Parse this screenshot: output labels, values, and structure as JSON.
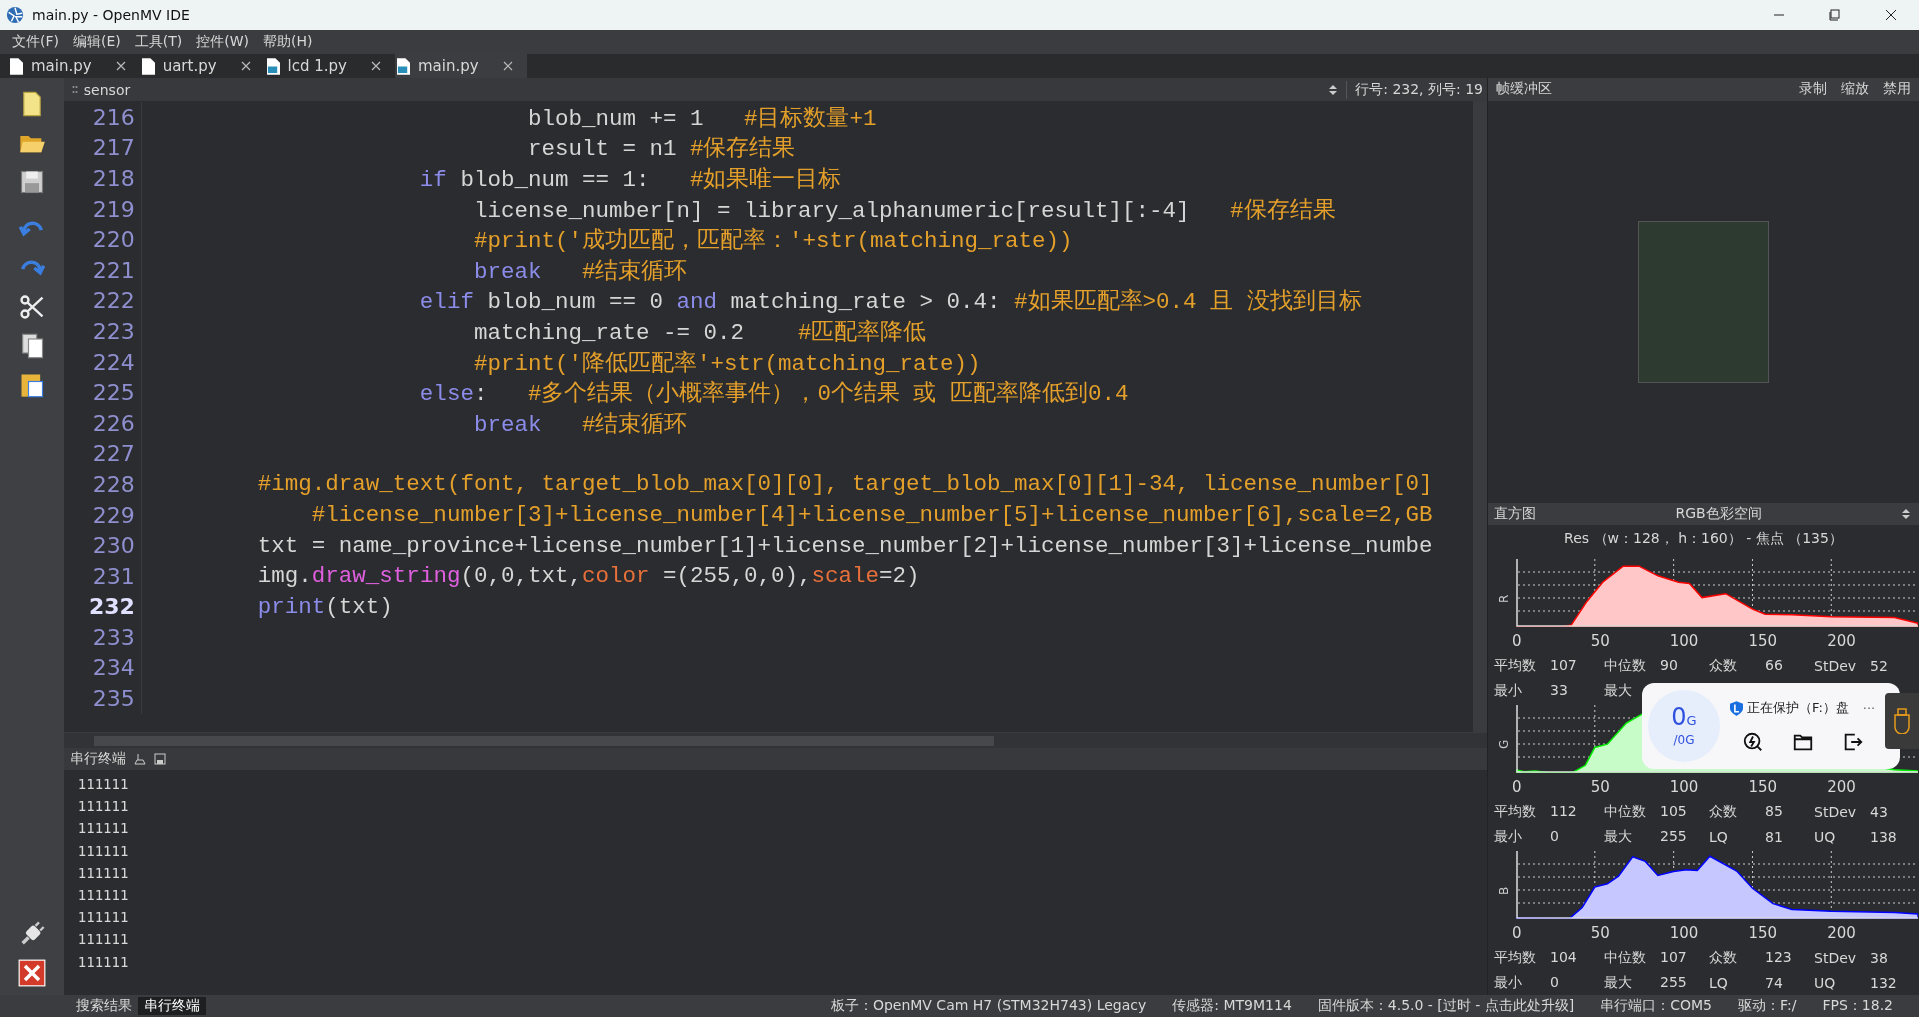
{
  "window": {
    "title": "main.py - OpenMV IDE"
  },
  "menu": [
    "文件(F)",
    "编辑(E)",
    "工具(T)",
    "控件(W)",
    "帮助(H)"
  ],
  "tabs": [
    {
      "label": "main.py",
      "kind": "file",
      "selected": false
    },
    {
      "label": "uart.py",
      "kind": "file",
      "selected": false
    },
    {
      "label": "lcd  1.py",
      "kind": "python",
      "selected": false
    },
    {
      "label": "main.py",
      "kind": "python",
      "selected": true
    }
  ],
  "editor": {
    "symbol": "sensor",
    "position": "行号: 232, 列号: 19",
    "lines": [
      {
        "number": "216",
        "current": false,
        "tokens": [
          {
            "text": "                            blob_num += 1   ",
            "kind": "plain"
          },
          {
            "text": "#目标数量+1",
            "kind": "comment"
          }
        ]
      },
      {
        "number": "217",
        "current": false,
        "tokens": [
          {
            "text": "                            result = n1 ",
            "kind": "plain"
          },
          {
            "text": "#保存结果",
            "kind": "comment"
          }
        ]
      },
      {
        "number": "218",
        "current": false,
        "tokens": [
          {
            "text": "                    if",
            "kind": "keyword"
          },
          {
            "text": " blob_num == 1:   ",
            "kind": "plain"
          },
          {
            "text": "#如果唯一目标",
            "kind": "comment"
          }
        ]
      },
      {
        "number": "219",
        "current": false,
        "tokens": [
          {
            "text": "                        license_number[n] = library_alphanumeric[result][:-4]   ",
            "kind": "plain"
          },
          {
            "text": "#保存结果",
            "kind": "comment"
          }
        ]
      },
      {
        "number": "220",
        "current": false,
        "tokens": [
          {
            "text": "                        #print('成功匹配，匹配率：'+str(matching_rate))",
            "kind": "comment"
          }
        ]
      },
      {
        "number": "221",
        "current": false,
        "tokens": [
          {
            "text": "                        break   ",
            "kind": "keyword"
          },
          {
            "text": "#结束循环",
            "kind": "comment"
          }
        ]
      },
      {
        "number": "222",
        "current": false,
        "tokens": [
          {
            "text": "                    elif",
            "kind": "keyword"
          },
          {
            "text": " blob_num == 0 ",
            "kind": "plain"
          },
          {
            "text": "and",
            "kind": "keyword"
          },
          {
            "text": " matching_rate > 0.4: ",
            "kind": "plain"
          },
          {
            "text": "#如果匹配率>0.4 且 没找到目标",
            "kind": "comment"
          }
        ]
      },
      {
        "number": "223",
        "current": false,
        "tokens": [
          {
            "text": "                        matching_rate -= 0.2    ",
            "kind": "plain"
          },
          {
            "text": "#匹配率降低",
            "kind": "comment"
          }
        ]
      },
      {
        "number": "224",
        "current": false,
        "tokens": [
          {
            "text": "                        #print('降低匹配率'+str(matching_rate))",
            "kind": "comment"
          }
        ]
      },
      {
        "number": "225",
        "current": false,
        "tokens": [
          {
            "text": "                    else",
            "kind": "keyword"
          },
          {
            "text": ":   ",
            "kind": "plain"
          },
          {
            "text": "#多个结果（小概率事件），0个结果 或 匹配率降低到0.4",
            "kind": "comment"
          }
        ]
      },
      {
        "number": "226",
        "current": false,
        "tokens": [
          {
            "text": "                        break   ",
            "kind": "keyword"
          },
          {
            "text": "#结束循环",
            "kind": "comment"
          }
        ]
      },
      {
        "number": "227",
        "current": false
      },
      {
        "number": "228",
        "current": false,
        "tokens": [
          {
            "text": "        #img.draw_text(font, target_blob_max[0][0], target_blob_max[0][1]-34, license_number[0]",
            "kind": "comment"
          }
        ]
      },
      {
        "number": "229",
        "current": false,
        "tokens": [
          {
            "text": "            #license_number[3]+license_number[4]+license_number[5]+license_number[6],scale=2,GB",
            "kind": "comment"
          }
        ]
      },
      {
        "number": "230",
        "current": false,
        "tokens": [
          {
            "text": "        txt = name_province+license_number[1]+license_number[2]+license_number[3]+license_numbe",
            "kind": "plain"
          }
        ]
      },
      {
        "number": "231",
        "current": false,
        "tokens": [
          {
            "text": "        img.",
            "kind": "plain"
          },
          {
            "text": "draw_string",
            "kind": "function"
          },
          {
            "text": "(0,0,txt,",
            "kind": "plain"
          },
          {
            "text": "color",
            "kind": "param"
          },
          {
            "text": " =(255,0,0),",
            "kind": "plain"
          },
          {
            "text": "scale",
            "kind": "param"
          },
          {
            "text": "=2)",
            "kind": "plain"
          }
        ]
      },
      {
        "number": "232",
        "current": true,
        "tokens": [
          {
            "text": "        print",
            "kind": "keyword"
          },
          {
            "text": "(txt)",
            "kind": "plain"
          }
        ]
      },
      {
        "number": "233",
        "current": false
      },
      {
        "number": "234",
        "current": false
      },
      {
        "number": "235",
        "current": false
      }
    ]
  },
  "terminal": {
    "title": "串行终端",
    "lines": [
      "111111",
      "111111",
      "111111",
      "111111",
      "111111",
      "111111",
      "111111",
      "111111",
      "111111"
    ]
  },
  "frame_buffer": {
    "title": "帧缓冲区",
    "actions": [
      "录制",
      "缩放",
      "禁用"
    ]
  },
  "histogram": {
    "title": "直方图",
    "color_space": "RGB色彩空间",
    "resolution": "Res （w：128， h：160） - 焦点 （135）",
    "channels": [
      {
        "name": "R",
        "color": "#ff0000",
        "ticks": [
          "0",
          "50",
          "100",
          "150",
          "200"
        ],
        "stats": [
          [
            [
              "平均数",
              "107"
            ],
            [
              "中位数",
              "90"
            ],
            [
              "众数",
              "66"
            ],
            [
              "StDev",
              "52"
            ]
          ],
          [
            [
              "最小",
              "33"
            ],
            [
              "最大"
            ]
          ]
        ]
      },
      {
        "name": "G",
        "color": "#00ee00",
        "ticks": [
          "0",
          "50",
          "100",
          "150",
          "200"
        ],
        "stats": [
          [
            [
              "平均数",
              "112"
            ],
            [
              "中位数",
              "105"
            ],
            [
              "众数",
              "85"
            ],
            [
              "StDev",
              "43"
            ]
          ],
          [
            [
              "最小",
              "0"
            ],
            [
              "最大",
              "255"
            ],
            [
              "LQ",
              "81"
            ],
            [
              "UQ",
              "138"
            ]
          ]
        ]
      },
      {
        "name": "B",
        "color": "#0000ff",
        "ticks": [
          "0",
          "50",
          "100",
          "150",
          "200"
        ],
        "stats": [
          [
            [
              "平均数",
              "104"
            ],
            [
              "中位数",
              "107"
            ],
            [
              "众数",
              "123"
            ],
            [
              "StDev",
              "38"
            ]
          ],
          [
            [
              "最小",
              "0"
            ],
            [
              "最大",
              "255"
            ],
            [
              "LQ",
              "74"
            ],
            [
              "UQ",
              "132"
            ]
          ]
        ]
      }
    ]
  },
  "popup": {
    "used": "0",
    "unit": "G",
    "total": "/0G",
    "status": "正在保护（F:）盘",
    "more": "···"
  },
  "bottom_tabs": [
    {
      "label": "搜索结果",
      "selected": false
    },
    {
      "label": "串行终端",
      "selected": true
    }
  ],
  "status_bar": [
    "板子：OpenMV Cam H7 (STM32H743) Legacy",
    "传感器: MT9M114",
    "固件版本：4.5.0 - [过时 - 点击此处升级]",
    "串行端口：COM5",
    "驱动：F:/",
    "FPS：18.2"
  ]
}
